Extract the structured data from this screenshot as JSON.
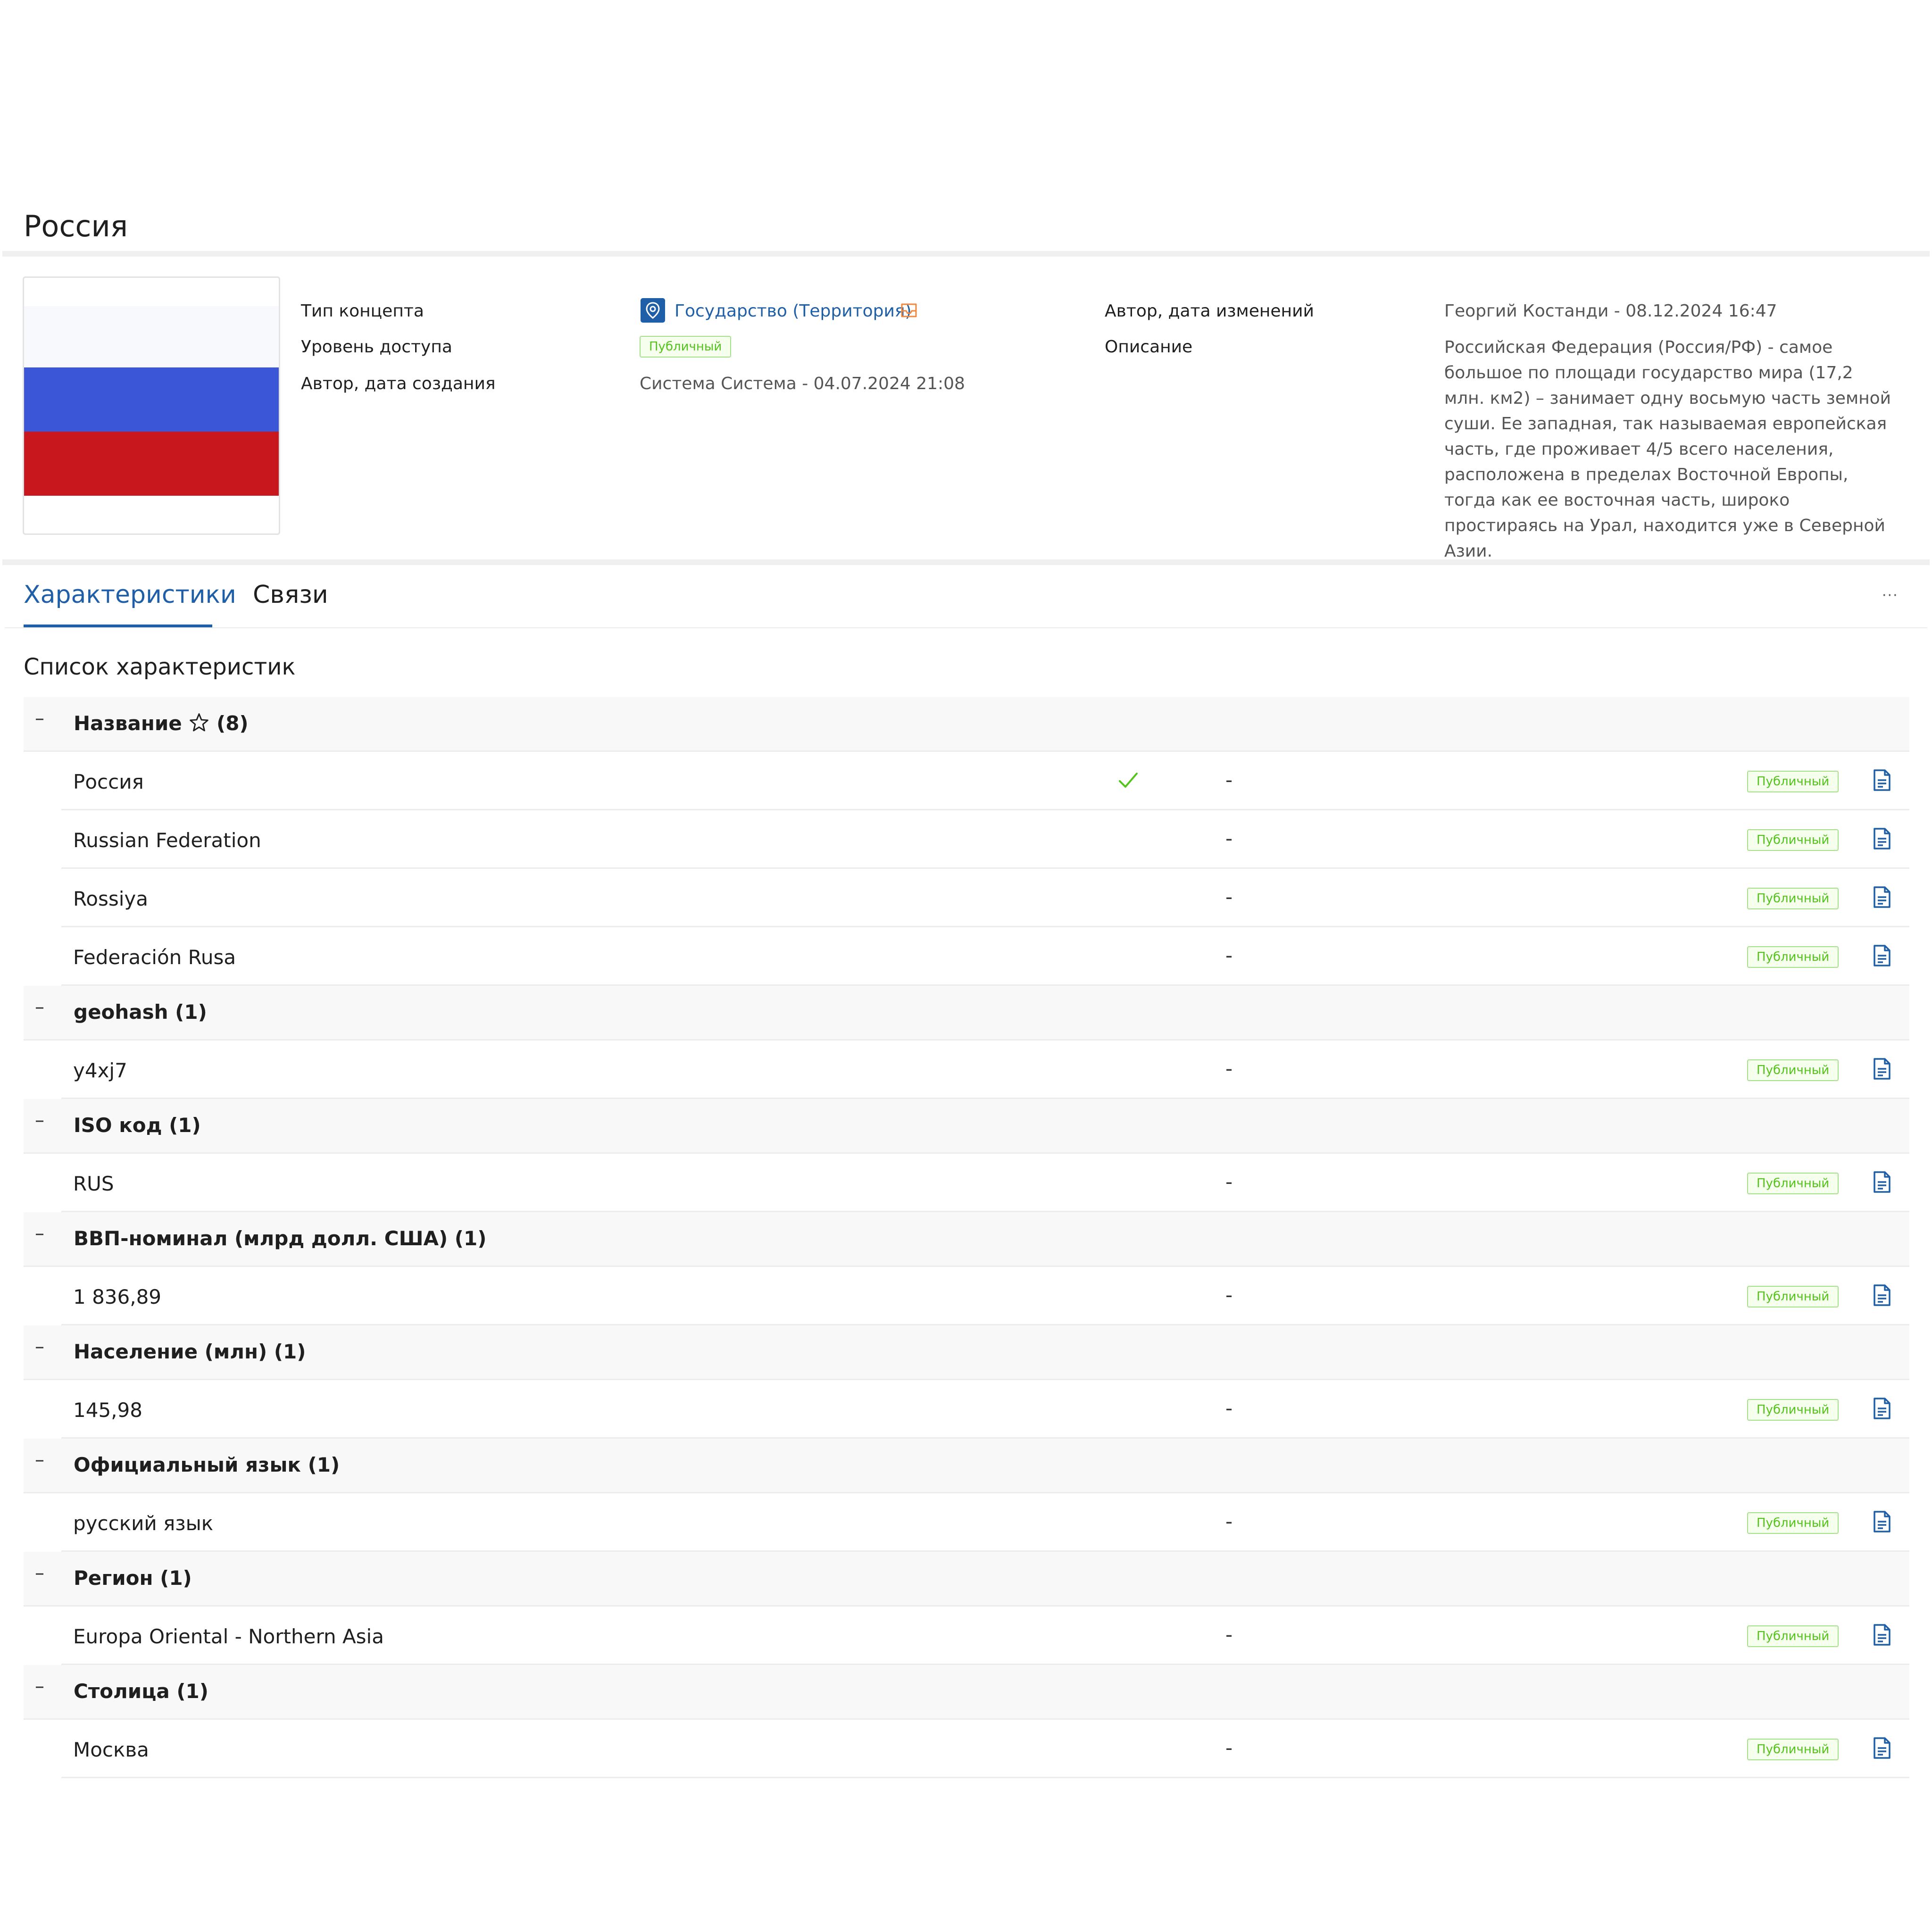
{
  "page": {
    "title": "Россия"
  },
  "colors": {
    "accent": "#1f5fa8",
    "badge_green": "#52c41a",
    "flag_white": "#f7f9fc",
    "flag_blue": "#3b57d8",
    "flag_red": "#c8181d"
  },
  "concept": {
    "type_label": "Тип концепта",
    "type_value": "Государство (Территория)",
    "access_label": "Уровень доступа",
    "access_value": "Публичный",
    "created_label": "Автор, дата создания",
    "created_value": "Система Система - 04.07.2024 21:08",
    "modified_label": "Автор, дата изменений",
    "modified_value": "Георгий  Костанди - 08.12.2024 16:47",
    "description_label": "Описание",
    "description_value": "Российская Федерация (Россия/РФ) - самое большое по площади государство мира (17,2 млн. км2) – занимает одну восьмую часть земной суши. Ее западная, так называемая европейская часть, где проживает 4/5 всего населения, расположена в пределах Восточной Европы, тогда как ее восточная часть, широко простираясь на Урал, находится уже в Северной Азии."
  },
  "tabs": [
    {
      "label": "Характеристики",
      "active": true
    },
    {
      "label": "Связи",
      "active": false
    }
  ],
  "more_label": "···",
  "characteristics": {
    "section_title": "Список характеристик",
    "groups": [
      {
        "name": "Название",
        "count": "(8)",
        "starred": true,
        "rows": [
          {
            "value": "Россия",
            "checked": true,
            "dash": "-",
            "badge": "Публичный"
          },
          {
            "value": "Russian Federation",
            "checked": false,
            "dash": "-",
            "badge": "Публичный"
          },
          {
            "value": "Rossiya",
            "checked": false,
            "dash": "-",
            "badge": "Публичный"
          },
          {
            "value": "Federación Rusa",
            "checked": false,
            "dash": "-",
            "badge": "Публичный"
          }
        ]
      },
      {
        "name": "geohash",
        "count": "(1)",
        "starred": false,
        "rows": [
          {
            "value": "y4xj7",
            "checked": false,
            "dash": "-",
            "badge": "Публичный"
          }
        ]
      },
      {
        "name": "ISO код",
        "count": "(1)",
        "starred": false,
        "rows": [
          {
            "value": "RUS",
            "checked": false,
            "dash": "-",
            "badge": "Публичный"
          }
        ]
      },
      {
        "name": "ВВП-номинал (млрд долл. США)",
        "count": "(1)",
        "starred": false,
        "rows": [
          {
            "value": "1 836,89",
            "checked": false,
            "dash": "-",
            "badge": "Публичный"
          }
        ]
      },
      {
        "name": "Население (млн)",
        "count": "(1)",
        "starred": false,
        "rows": [
          {
            "value": "145,98",
            "checked": false,
            "dash": "-",
            "badge": "Публичный"
          }
        ]
      },
      {
        "name": "Официальный язык",
        "count": "(1)",
        "starred": false,
        "rows": [
          {
            "value": "русский язык",
            "checked": false,
            "dash": "-",
            "badge": "Публичный"
          }
        ]
      },
      {
        "name": "Регион",
        "count": "(1)",
        "starred": false,
        "rows": [
          {
            "value": "Europa Oriental - Northern Asia",
            "checked": false,
            "dash": "-",
            "badge": "Публичный"
          }
        ]
      },
      {
        "name": "Столица",
        "count": "(1)",
        "starred": false,
        "rows": [
          {
            "value": "Москва",
            "checked": false,
            "dash": "-",
            "badge": "Публичный"
          }
        ]
      }
    ]
  }
}
